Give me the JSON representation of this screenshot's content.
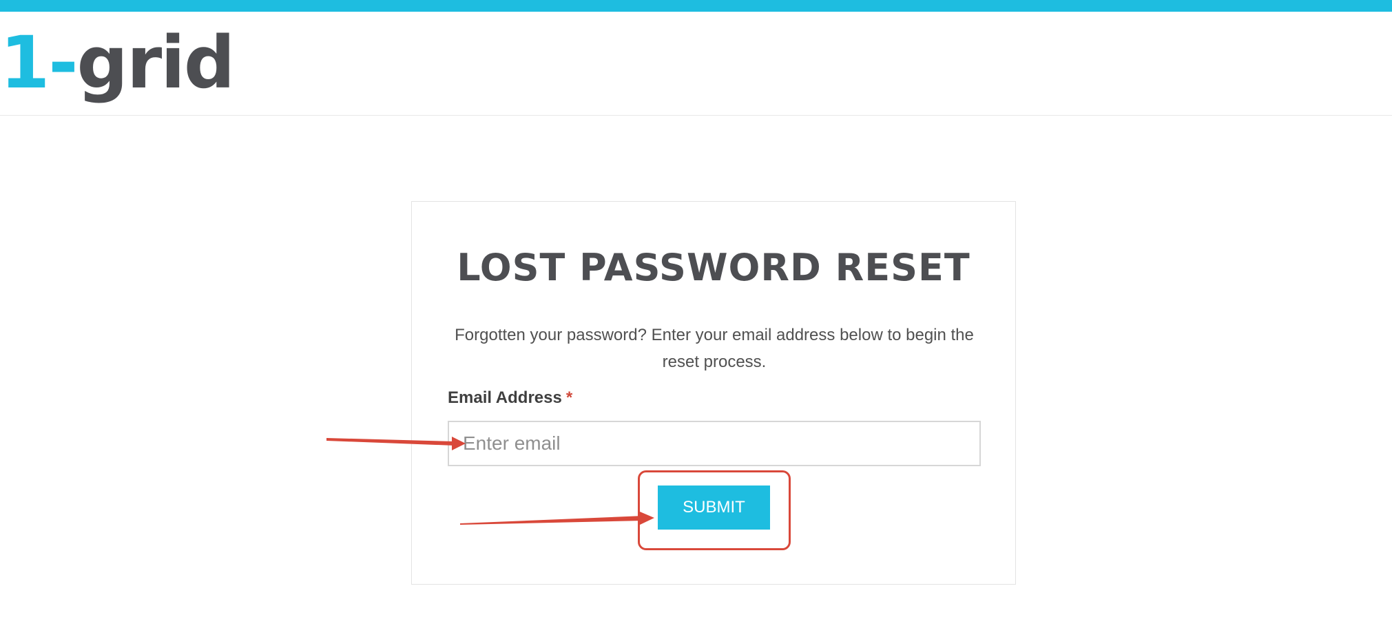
{
  "brand": {
    "logo_number": "1-",
    "logo_word": "grid",
    "accent_color": "#1ebde0",
    "logo_dark_color": "#4d4e52"
  },
  "reset_form": {
    "title": "LOST PASSWORD RESET",
    "description": "Forgotten your password? Enter your email address below to begin the reset process.",
    "email_label": "Email Address",
    "required_marker": "*",
    "email_placeholder": "Enter email",
    "email_value": "",
    "submit_label": "SUBMIT"
  },
  "annotations": {
    "arrow_color": "#d9483a",
    "highlight_color": "#d9483a"
  }
}
